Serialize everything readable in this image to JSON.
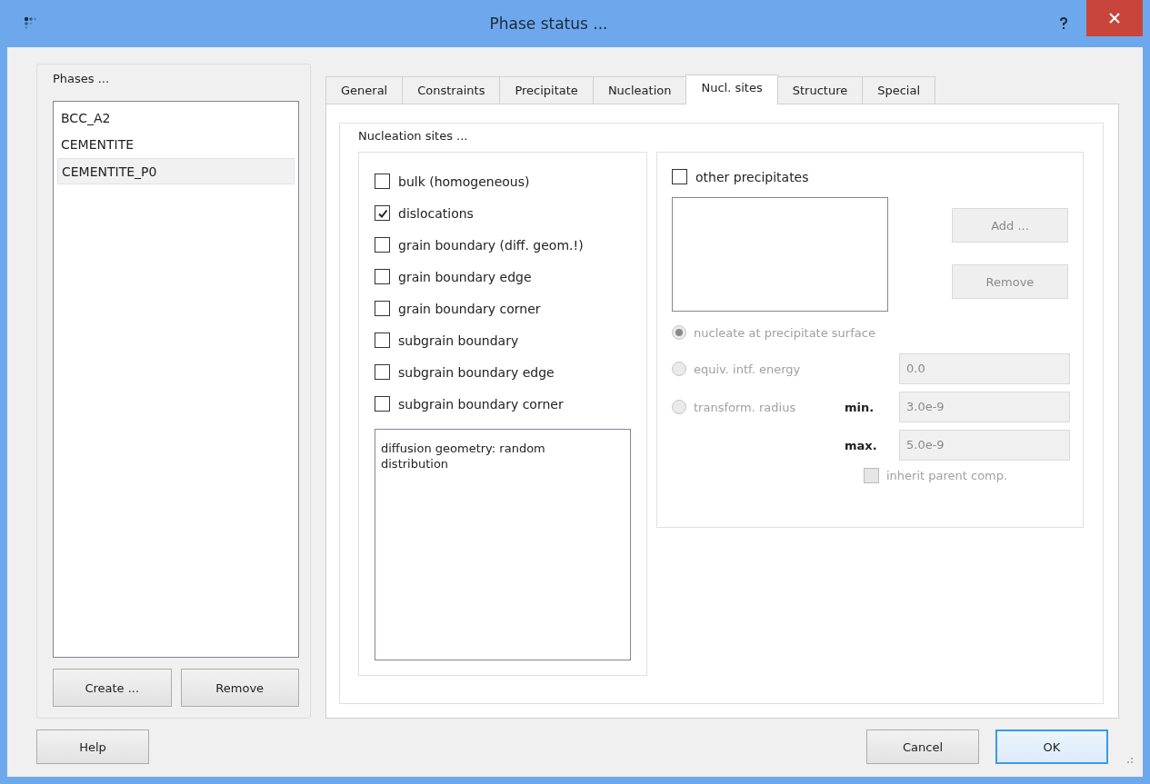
{
  "window": {
    "title": "Phase status ..."
  },
  "phases": {
    "label": "Phases ...",
    "items": [
      {
        "label": "BCC_A2",
        "selected": false
      },
      {
        "label": "CEMENTITE",
        "selected": false
      },
      {
        "label": "CEMENTITE_P0",
        "selected": true
      }
    ],
    "buttons": [
      "Create ...",
      "Remove"
    ]
  },
  "tabs": [
    {
      "label": "General",
      "selected": false
    },
    {
      "label": "Constraints",
      "selected": false
    },
    {
      "label": "Precipitate",
      "selected": false
    },
    {
      "label": "Nucleation",
      "selected": false
    },
    {
      "label": "Nucl. sites",
      "selected": true
    },
    {
      "label": "Structure",
      "selected": false
    },
    {
      "label": "Special",
      "selected": false
    }
  ],
  "nucleation_sites": {
    "label": "Nucleation sites ...",
    "sites": [
      {
        "label": "bulk (homogeneous)",
        "checked": false
      },
      {
        "label": "dislocations",
        "checked": true
      },
      {
        "label": "grain boundary (diff. geom.!)",
        "checked": false
      },
      {
        "label": "grain boundary edge",
        "checked": false
      },
      {
        "label": "grain boundary corner",
        "checked": false
      },
      {
        "label": "subgrain boundary",
        "checked": false
      },
      {
        "label": "subgrain boundary edge",
        "checked": false
      },
      {
        "label": "subgrain boundary corner",
        "checked": false
      }
    ],
    "description": "diffusion geometry: random distribution",
    "other_precipitates": {
      "label": "other precipitates",
      "checked": false,
      "buttons": [
        {
          "label": "Add ...",
          "disabled": true
        },
        {
          "label": "Remove",
          "disabled": true
        }
      ],
      "options": [
        {
          "label": "nucleate at precipitate surface",
          "selected": true,
          "disabled": true
        },
        {
          "label": "equiv. intf. energy",
          "selected": false,
          "disabled": true,
          "fields": [
            {
              "value": "0.0"
            }
          ]
        },
        {
          "label": "transform. radius",
          "selected": false,
          "disabled": true,
          "fields": [
            {
              "label": "min.",
              "value": "3.0e-9"
            },
            {
              "label": "max.",
              "value": "5.0e-9"
            }
          ]
        }
      ],
      "inherit": {
        "label": "inherit parent comp.",
        "checked": false,
        "disabled": true
      }
    }
  },
  "footer": {
    "buttons": [
      {
        "label": "Help",
        "default": false
      },
      {
        "label": "Cancel",
        "default": false
      },
      {
        "label": "OK",
        "default": true
      }
    ]
  }
}
